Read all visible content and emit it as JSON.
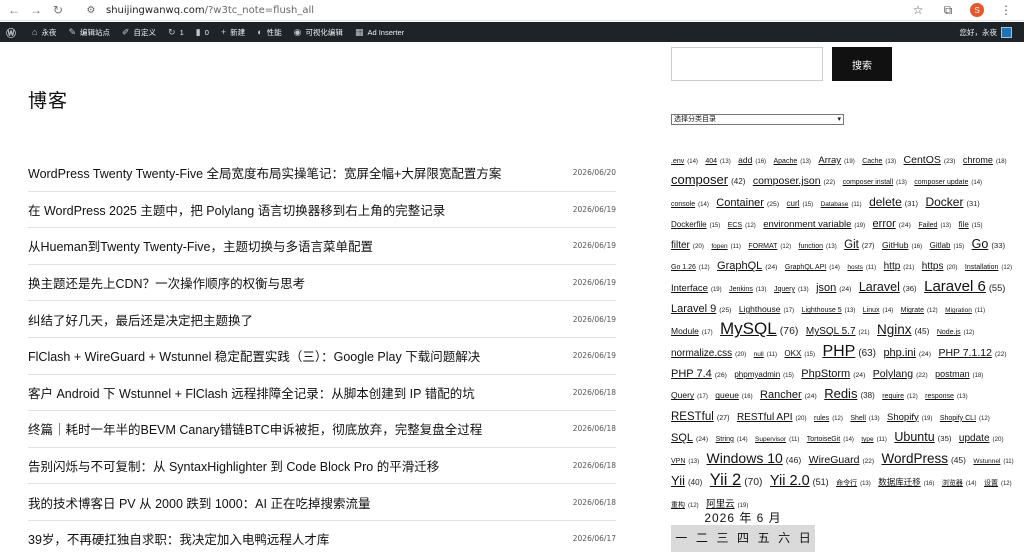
{
  "browser": {
    "url_host": "shuijingwanwq.com",
    "url_path": "/?w3tc_note=flush_all",
    "back_icon": "arrow-left-icon",
    "forward_icon": "arrow-right-icon",
    "reload_icon": "reload-icon",
    "badge": "S"
  },
  "adminbar": {
    "wp_logo": "W",
    "items": [
      {
        "icon": "home-icon",
        "label": "永夜"
      },
      {
        "icon": "brush-icon",
        "label": "编辑站点"
      },
      {
        "icon": "pencil-icon",
        "label": "自定义"
      },
      {
        "icon": "refresh-icon",
        "label": "1"
      },
      {
        "icon": "comment-icon",
        "label": "0"
      },
      {
        "icon": "plus-icon",
        "label": "新建"
      },
      {
        "icon": "gauge-icon",
        "label": "性能"
      },
      {
        "icon": "eye-icon",
        "label": "可视化编辑"
      },
      {
        "icon": "grid-icon",
        "label": "Ad Inserter"
      }
    ],
    "greeting": "您好，永夜"
  },
  "main": {
    "title": "博客",
    "posts": [
      {
        "title": "WordPress Twenty Twenty-Five 全局宽度布局实操笔记：宽屏全幅+大屏限宽配置方案",
        "date": "2026/06/20"
      },
      {
        "title": "在 WordPress 2025 主题中，把 Polylang 语言切换器移到右上角的完整记录",
        "date": "2026/06/19"
      },
      {
        "title": "从Hueman到Twenty Twenty-Five，主题切换与多语言菜单配置",
        "date": "2026/06/19"
      },
      {
        "title": "换主题还是先上CDN？一次操作顺序的权衡与思考",
        "date": "2026/06/19"
      },
      {
        "title": "纠结了好几天，最后还是决定把主题换了",
        "date": "2026/06/19"
      },
      {
        "title": "FlClash + WireGuard + Wstunnel 稳定配置实践（三）：Google Play 下载问题解决",
        "date": "2026/06/19"
      },
      {
        "title": "客户 Android 下 Wstunnel + FlClash 远程排障全记录：从脚本创建到 IP 错配的坑",
        "date": "2026/06/18"
      },
      {
        "title": "终篇｜耗时一年半的BEVM Canary错链BTC申诉被拒，彻底放弃，完整复盘全过程",
        "date": "2026/06/18"
      },
      {
        "title": "告别闪烁与不可复制：从 SyntaxHighlighter 到 Code Block Pro 的平滑迁移",
        "date": "2026/06/18"
      },
      {
        "title": "我的技术博客日 PV 从 2000 跌到 1000：AI 正在吃掉搜索流量",
        "date": "2026/06/18"
      },
      {
        "title": "39岁，不再硬扛独自求职：我决定加入电鸭远程人才库",
        "date": "2026/06/17"
      }
    ]
  },
  "sidebar": {
    "search_button": "搜索",
    "search_placeholder": "",
    "category_select": "选择分类目录",
    "tags": [
      {
        "name": ".env",
        "count": "(14)",
        "size": 7
      },
      {
        "name": "404",
        "count": "(13)",
        "size": 7
      },
      {
        "name": "add",
        "count": "(16)",
        "size": 8.5
      },
      {
        "name": "Apache",
        "count": "(13)",
        "size": 7
      },
      {
        "name": "Array",
        "count": "(19)",
        "size": 9.5
      },
      {
        "name": "Cache",
        "count": "(13)",
        "size": 7
      },
      {
        "name": "CentOS",
        "count": "(23)",
        "size": 10.5
      },
      {
        "name": "chrome",
        "count": "(18)",
        "size": 9
      },
      {
        "name": "composer",
        "count": "(42)",
        "size": 13
      },
      {
        "name": "composer.json",
        "count": "(22)",
        "size": 10.5
      },
      {
        "name": "composer install",
        "count": "(13)",
        "size": 7
      },
      {
        "name": "composer update",
        "count": "(14)",
        "size": 7
      },
      {
        "name": "console",
        "count": "(14)",
        "size": 7
      },
      {
        "name": "Container",
        "count": "(25)",
        "size": 11
      },
      {
        "name": "curl",
        "count": "(15)",
        "size": 8
      },
      {
        "name": "Database",
        "count": "(11)",
        "size": 6.5
      },
      {
        "name": "delete",
        "count": "(31)",
        "size": 12
      },
      {
        "name": "Docker",
        "count": "(31)",
        "size": 12
      },
      {
        "name": "Dockerfile",
        "count": "(15)",
        "size": 8
      },
      {
        "name": "ECS",
        "count": "(12)",
        "size": 7
      },
      {
        "name": "environment variable",
        "count": "(19)",
        "size": 9.5
      },
      {
        "name": "error",
        "count": "(24)",
        "size": 11
      },
      {
        "name": "Failed",
        "count": "(13)",
        "size": 7
      },
      {
        "name": "file",
        "count": "(15)",
        "size": 8
      },
      {
        "name": "filter",
        "count": "(20)",
        "size": 10
      },
      {
        "name": "fopen",
        "count": "(11)",
        "size": 6.5
      },
      {
        "name": "FORMAT",
        "count": "(12)",
        "size": 7
      },
      {
        "name": "function",
        "count": "(13)",
        "size": 7
      },
      {
        "name": "Git",
        "count": "(27)",
        "size": 11.5
      },
      {
        "name": "GitHub",
        "count": "(16)",
        "size": 8.5
      },
      {
        "name": "Gitlab",
        "count": "(15)",
        "size": 8
      },
      {
        "name": "Go",
        "count": "(33)",
        "size": 12.5
      },
      {
        "name": "Go 1.26",
        "count": "(12)",
        "size": 7
      },
      {
        "name": "GraphQL",
        "count": "(24)",
        "size": 11
      },
      {
        "name": "GraphQL API",
        "count": "(14)",
        "size": 7
      },
      {
        "name": "hosts",
        "count": "(11)",
        "size": 6.5
      },
      {
        "name": "http",
        "count": "(21)",
        "size": 10
      },
      {
        "name": "https",
        "count": "(20)",
        "size": 10
      },
      {
        "name": "Installation",
        "count": "(12)",
        "size": 7
      },
      {
        "name": "Interface",
        "count": "(19)",
        "size": 9.5
      },
      {
        "name": "Jenkins",
        "count": "(13)",
        "size": 7
      },
      {
        "name": "Jquery",
        "count": "(13)",
        "size": 7
      },
      {
        "name": "json",
        "count": "(24)",
        "size": 11
      },
      {
        "name": "Laravel",
        "count": "(36)",
        "size": 12.5
      },
      {
        "name": "Laravel 6",
        "count": "(55)",
        "size": 15
      },
      {
        "name": "Laravel 9",
        "count": "(25)",
        "size": 11
      },
      {
        "name": "Lighthouse",
        "count": "(17)",
        "size": 8.5
      },
      {
        "name": "Lighthouse 5",
        "count": "(13)",
        "size": 7
      },
      {
        "name": "Linux",
        "count": "(14)",
        "size": 7
      },
      {
        "name": "Migrate",
        "count": "(12)",
        "size": 7
      },
      {
        "name": "Migration",
        "count": "(11)",
        "size": 6.5
      },
      {
        "name": "Module",
        "count": "(17)",
        "size": 8.5
      },
      {
        "name": "MySQL",
        "count": "(76)",
        "size": 17
      },
      {
        "name": "MySQL 5.7",
        "count": "(21)",
        "size": 10
      },
      {
        "name": "Nginx",
        "count": "(45)",
        "size": 13.5
      },
      {
        "name": "Node.js",
        "count": "(12)",
        "size": 7
      },
      {
        "name": "normalize.css",
        "count": "(20)",
        "size": 10
      },
      {
        "name": "null",
        "count": "(11)",
        "size": 6.5
      },
      {
        "name": "OKX",
        "count": "(15)",
        "size": 8
      },
      {
        "name": "PHP",
        "count": "(63)",
        "size": 16
      },
      {
        "name": "php.ini",
        "count": "(24)",
        "size": 11
      },
      {
        "name": "PHP 7.1.12",
        "count": "(22)",
        "size": 10.5
      },
      {
        "name": "PHP 7.4",
        "count": "(26)",
        "size": 11
      },
      {
        "name": "phpmyadmin",
        "count": "(15)",
        "size": 8
      },
      {
        "name": "PhpStorm",
        "count": "(24)",
        "size": 11
      },
      {
        "name": "Polylang",
        "count": "(22)",
        "size": 10.5
      },
      {
        "name": "postman",
        "count": "(18)",
        "size": 9
      },
      {
        "name": "Query",
        "count": "(17)",
        "size": 8.5
      },
      {
        "name": "queue",
        "count": "(16)",
        "size": 8.5
      },
      {
        "name": "Rancher",
        "count": "(24)",
        "size": 11
      },
      {
        "name": "Redis",
        "count": "(38)",
        "size": 13
      },
      {
        "name": "require",
        "count": "(12)",
        "size": 7
      },
      {
        "name": "response",
        "count": "(13)",
        "size": 7
      },
      {
        "name": "RESTful",
        "count": "(27)",
        "size": 11.5
      },
      {
        "name": "RESTful API",
        "count": "(20)",
        "size": 10
      },
      {
        "name": "rules",
        "count": "(12)",
        "size": 7
      },
      {
        "name": "Shell",
        "count": "(13)",
        "size": 7
      },
      {
        "name": "Shopify",
        "count": "(19)",
        "size": 9.5
      },
      {
        "name": "Shopify CLI",
        "count": "(12)",
        "size": 7
      },
      {
        "name": "SQL",
        "count": "(24)",
        "size": 11
      },
      {
        "name": "String",
        "count": "(14)",
        "size": 7
      },
      {
        "name": "Supervisor",
        "count": "(11)",
        "size": 6.5
      },
      {
        "name": "TortoiseGit",
        "count": "(14)",
        "size": 7
      },
      {
        "name": "type",
        "count": "(11)",
        "size": 6.5
      },
      {
        "name": "Ubuntu",
        "count": "(35)",
        "size": 12.5
      },
      {
        "name": "update",
        "count": "(20)",
        "size": 10
      },
      {
        "name": "VPN",
        "count": "(13)",
        "size": 7
      },
      {
        "name": "Windows 10",
        "count": "(46)",
        "size": 14
      },
      {
        "name": "WireGuard",
        "count": "(22)",
        "size": 10.5
      },
      {
        "name": "WordPress",
        "count": "(45)",
        "size": 13.5
      },
      {
        "name": "Wstunnel",
        "count": "(11)",
        "size": 6.5
      },
      {
        "name": "Yii",
        "count": "(40)",
        "size": 13
      },
      {
        "name": "Yii 2",
        "count": "(70)",
        "size": 16.5
      },
      {
        "name": "Yii 2.0",
        "count": "(51)",
        "size": 14.5
      },
      {
        "name": "命令行",
        "count": "(13)",
        "size": 7
      },
      {
        "name": "数据库迁移",
        "count": "(16)",
        "size": 8.5
      },
      {
        "name": "浏览器",
        "count": "(14)",
        "size": 7
      },
      {
        "name": "设置",
        "count": "(12)",
        "size": 7
      },
      {
        "name": "重构",
        "count": "(12)",
        "size": 7
      },
      {
        "name": "阿里云",
        "count": "(19)",
        "size": 9.5
      }
    ],
    "calendar": {
      "caption": "2026 年 6 月",
      "weekdays": [
        "一",
        "二",
        "三",
        "四",
        "五",
        "六",
        "日"
      ]
    }
  }
}
